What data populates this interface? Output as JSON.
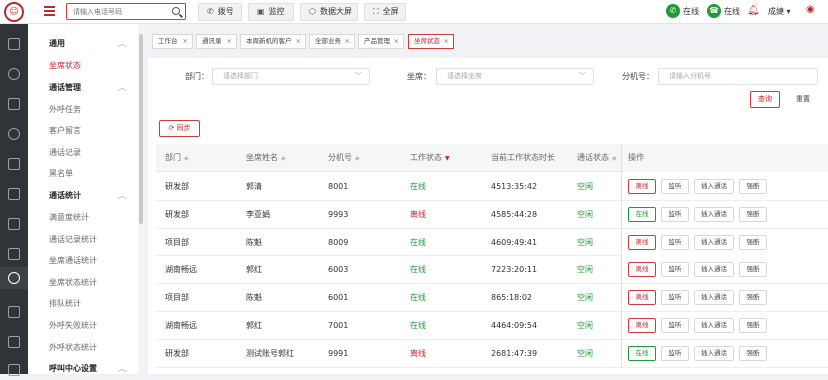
{
  "topbar": {
    "logo_text": "",
    "search_placeholder": "请输入电话号码",
    "buttons": [
      {
        "label": "拨号",
        "icon": "phone-icon"
      },
      {
        "label": "监控",
        "icon": "monitor-icon"
      },
      {
        "label": "数据大屏",
        "icon": "screen-icon"
      },
      {
        "label": "全屏",
        "icon": "fullscreen-icon"
      }
    ],
    "status1": "在线",
    "status2": "在线",
    "user": "成婕 ▾",
    "colors": {
      "brand": "#c0282d",
      "online": "#1c9b36"
    }
  },
  "sidebar": {
    "groups": [
      {
        "title": "通用",
        "items": [
          "坐席状态"
        ]
      },
      {
        "title": "通话管理",
        "items": [
          "外呼任务",
          "客户留言",
          "通话记录",
          "黑名单"
        ]
      },
      {
        "title": "通话统计",
        "items": [
          "满意度统计",
          "通话记录统计",
          "坐席通话统计",
          "坐席状态统计",
          "排队统计",
          "外呼失败统计",
          "外呼状态统计"
        ]
      },
      {
        "title": "呼叫中心设置",
        "items": []
      }
    ],
    "active_item": "坐席状态"
  },
  "tabs": [
    {
      "label": "工作台"
    },
    {
      "label": "通讯录"
    },
    {
      "label": "本周新机的客户"
    },
    {
      "label": "全部业务"
    },
    {
      "label": "产品管理"
    },
    {
      "label": "坐席状态",
      "active": true
    }
  ],
  "filters": {
    "dept_label": "部门：",
    "dept_placeholder": "请选择部门",
    "seat_label": "坐席：",
    "seat_placeholder": "请选择坐席",
    "ext_label": "分机号：",
    "ext_placeholder": "请输入分机号",
    "query": "查询",
    "reset": "重置",
    "sync": "同步"
  },
  "table": {
    "headers": [
      "部门",
      "坐席姓名",
      "分机号",
      "工作状态",
      "当前工作状态时长",
      "通话状态",
      "操作"
    ],
    "actions": [
      "监听",
      "插入通话",
      "强断"
    ],
    "rows": [
      {
        "dept": "研发部",
        "name": "郭清",
        "ext": "8001",
        "work": "在线",
        "work_color": "green",
        "duration": "4513:35:42",
        "call": "空闲",
        "toggle": "离线"
      },
      {
        "dept": "研发部",
        "name": "李亚娟",
        "ext": "9993",
        "work": "离线",
        "work_color": "red",
        "duration": "4585:44:28",
        "call": "空闲",
        "toggle": "在线"
      },
      {
        "dept": "项目部",
        "name": "陈魁",
        "ext": "8009",
        "work": "在线",
        "work_color": "green",
        "duration": "4609:49:41",
        "call": "空闲",
        "toggle": "离线"
      },
      {
        "dept": "湖南畅远",
        "name": "郭红",
        "ext": "6003",
        "work": "在线",
        "work_color": "green",
        "duration": "7223:20:11",
        "call": "空闲",
        "toggle": "离线"
      },
      {
        "dept": "项目部",
        "name": "陈魁",
        "ext": "6001",
        "work": "在线",
        "work_color": "green",
        "duration": "865:18:02",
        "call": "空闲",
        "toggle": "离线"
      },
      {
        "dept": "湖南畅远",
        "name": "郭红",
        "ext": "7001",
        "work": "在线",
        "work_color": "green",
        "duration": "4464:09:54",
        "call": "空闲",
        "toggle": "离线"
      },
      {
        "dept": "研发部",
        "name": "测试账号郭红",
        "ext": "9991",
        "work": "离线",
        "work_color": "red",
        "duration": "2681:47:39",
        "call": "空闲",
        "toggle": "在线"
      }
    ]
  }
}
